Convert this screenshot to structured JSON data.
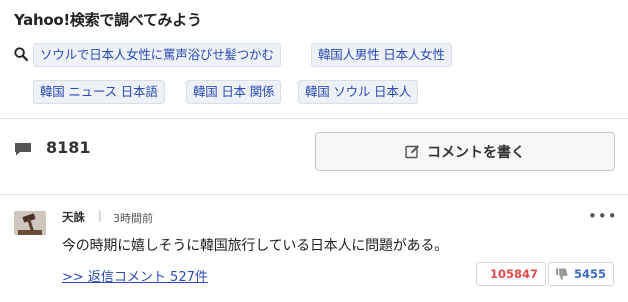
{
  "search": {
    "title": "Yahoo!検索で調べてみよう",
    "suggestions": [
      "ソウルで日本人女性に罵声浴びせ髪つかむ",
      "韓国人男性 日本人女性",
      "韓国 ニュース 日本語",
      "韓国 日本 関係",
      "韓国 ソウル 日本人"
    ]
  },
  "comments_header": {
    "count": "8181",
    "write_label": "コメントを書く"
  },
  "comment": {
    "username": "天誅",
    "divider": "|",
    "timestamp": "3時間前",
    "more": "•••",
    "body": "今の時期に嬉しそうに韓国旅行している日本人に問題がある。",
    "replies_link": ">> 返信コメント 527件",
    "likes": "105847",
    "dislikes": "5455"
  },
  "colors": {
    "link": "#2a4bb5",
    "like": "#e24b4b",
    "dislike": "#3d6bc4"
  }
}
